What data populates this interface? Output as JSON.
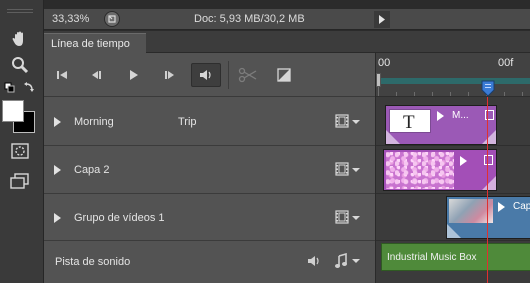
{
  "status": {
    "zoom": "33,33%",
    "doc_info": "Doc: 5,93 MB/30,2 MB"
  },
  "panel": {
    "tab_label": "Línea de tiempo"
  },
  "controls": [
    {
      "name": "go-to-first-frame",
      "icon": "skip-to-start-icon"
    },
    {
      "name": "previous-frame",
      "icon": "step-back-icon"
    },
    {
      "name": "play",
      "icon": "play-icon"
    },
    {
      "name": "next-frame",
      "icon": "step-forward-icon"
    },
    {
      "name": "audio",
      "icon": "speaker-icon"
    },
    {
      "name": "split-at-playhead",
      "icon": "scissors-icon"
    },
    {
      "name": "transition",
      "icon": "transition-icon"
    }
  ],
  "tracks": {
    "morning": {
      "label": "Morning",
      "label2": "Trip"
    },
    "capa2": {
      "label": "Capa 2"
    },
    "group": {
      "label": "Grupo de vídeos 1"
    },
    "audio": {
      "label": "Pista de sonido"
    }
  },
  "ruler": {
    "start_label": "00",
    "playhead_label": "00f"
  },
  "clips": {
    "text_clip_label": "M...",
    "text_clip_glyph": "T",
    "video_clip_label": "Cap",
    "audio_clip_label": "Industrial Music Box"
  },
  "colors": {
    "text_clip": "#9b59b6",
    "image_clip": "#a34fb7",
    "video_clip": "#4a7aa8",
    "audio_clip": "#4f8a3a",
    "playhead": "#e03030",
    "work_area": "#2d6a6a"
  }
}
